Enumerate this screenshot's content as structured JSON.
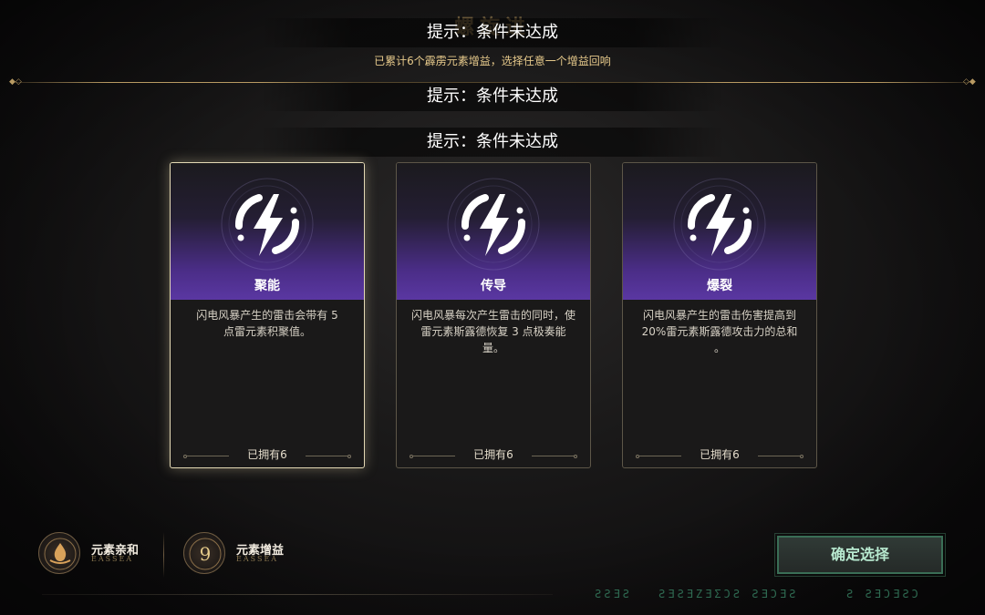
{
  "header": {
    "title_ghost": "螺旋进",
    "subtitle": "已累计6个霹雳元素增益，选择任意一个增益回响"
  },
  "toasts": [
    "提示：条件未达成",
    "提示：条件未达成",
    "提示：条件未达成"
  ],
  "cards": [
    {
      "name": "聚能",
      "desc_line1": "闪电风暴产生的雷击会带有 5",
      "desc_line2": "点雷元素积聚值。",
      "owned": "已拥有6",
      "selected": true
    },
    {
      "name": "传导",
      "desc_line1": "闪电风暴每次产生雷击的同时，使",
      "desc_line2": "雷元素斯露德恢复 3 点极奏能量。",
      "owned": "已拥有6",
      "selected": false
    },
    {
      "name": "爆裂",
      "desc_line1": "闪电风暴产生的雷击伤害提高到",
      "desc_line2": "20%雷元素斯露德攻击力的总和 。",
      "owned": "已拥有6",
      "selected": false
    }
  ],
  "status": {
    "affinity": {
      "label": "元素亲和",
      "sub": "EASSEA",
      "icon": "element-affinity-icon"
    },
    "boost": {
      "label": "元素增益",
      "sub": "EASSEA",
      "count": "9",
      "icon": "element-boost-icon"
    }
  },
  "confirm_label": "确定选择",
  "runes": [
    "ƧƧƎƧ",
    "ƧƎƧƎZƎΣƆƧ ƧƎƆƎƧ",
    "Ƨ ƧƎƆƎƧƆ"
  ],
  "colors": {
    "card_purple": "#5a37a2",
    "selected_border": "#e4d9b5",
    "gold_text": "#e6c98b",
    "confirm_green": "#3a6e56"
  }
}
